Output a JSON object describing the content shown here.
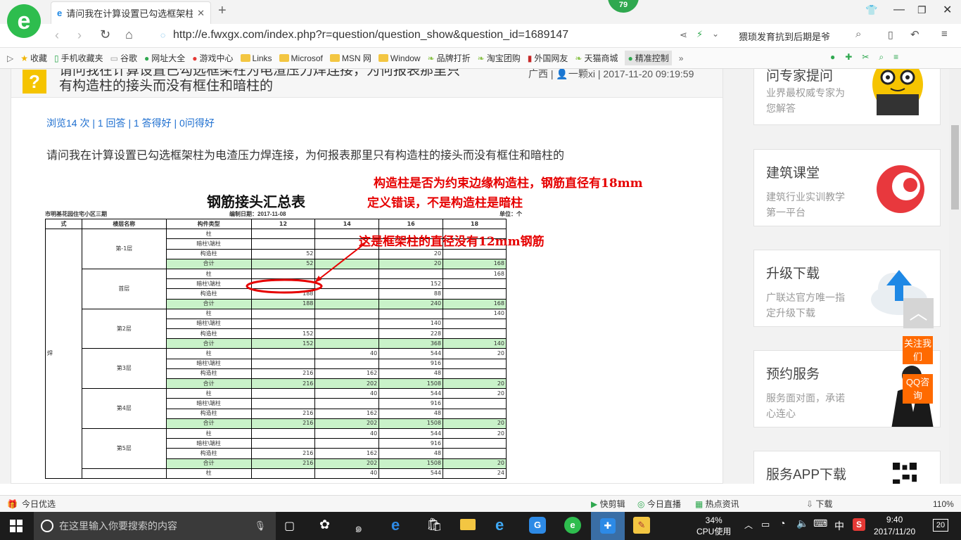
{
  "browser": {
    "tab_title": "请问我在计算设置已勾选框架柱为",
    "url": "http://e.fwxgx.com/index.php?r=question/question_show&question_id=1689147",
    "search_text": "猥琐发育抗到后期是爷",
    "badge_count": "79",
    "zoom": "110%"
  },
  "favorites": [
    "收藏",
    "手机收藏夹",
    "谷歌",
    "网址大全",
    "游戏中心",
    "Links",
    "Microsof",
    "MSN 网",
    "Window",
    "品牌打折",
    "淘宝团购",
    "外国网友",
    "天猫商城",
    "精准控制"
  ],
  "question": {
    "title_line1": "请问我在计算设置已勾选框架柱为电渣压力焊连接，为何报表那里只",
    "title_line2": "有构造柱的接头而没有框住和暗柱的",
    "meta_region": "广西",
    "meta_user": "一颗xi",
    "meta_date": "2017-11-20 09:19:59",
    "stats": "浏览14 次 | 1 回答 | 1 答得好 | 0问得好",
    "body": "请问我在计算设置已勾选框架柱为电渣压力焊连接，为何报表那里只有构造柱的接头而没有框住和暗柱的",
    "annotation1": "构造柱是否为约束边缘构造柱，钢筋直径有18mm",
    "annotation2": "定义错误，不是构造柱是暗柱",
    "annotation3": "这是框架柱的直径没有12mm钢筋"
  },
  "report": {
    "title": "钢筋接头汇总表",
    "project": "市明基花园住宅小区三期",
    "date_label": "编制日期：2017-11-08",
    "unit_label": "单位：个",
    "headers": [
      "式",
      "楼层名称",
      "构件类型",
      "12",
      "14",
      "16",
      "18"
    ],
    "side_label": "焊",
    "floors": [
      {
        "name": "第-1层",
        "rows": [
          [
            "柱",
            "",
            "",
            "",
            ""
          ],
          [
            "暗柱\\端柱",
            "",
            "",
            "",
            ""
          ],
          [
            "构造柱",
            "52",
            "",
            "20",
            ""
          ],
          [
            "合计",
            "52",
            "",
            "20",
            "168"
          ]
        ]
      },
      {
        "name": "首层",
        "rows": [
          [
            "柱",
            "",
            "",
            "",
            "168"
          ],
          [
            "暗柱\\端柱",
            "",
            "",
            "152",
            ""
          ],
          [
            "构造柱",
            "188",
            "",
            "88",
            ""
          ],
          [
            "合计",
            "188",
            "",
            "240",
            "168"
          ]
        ]
      },
      {
        "name": "第2层",
        "rows": [
          [
            "柱",
            "",
            "",
            "",
            "140"
          ],
          [
            "暗柱\\端柱",
            "",
            "",
            "140",
            ""
          ],
          [
            "构造柱",
            "152",
            "",
            "228",
            ""
          ],
          [
            "合计",
            "152",
            "",
            "368",
            "140"
          ]
        ]
      },
      {
        "name": "第3层",
        "rows": [
          [
            "柱",
            "",
            "40",
            "544",
            "20"
          ],
          [
            "暗柱\\端柱",
            "",
            "",
            "916",
            ""
          ],
          [
            "构造柱",
            "216",
            "162",
            "48",
            ""
          ],
          [
            "合计",
            "216",
            "202",
            "1508",
            "20"
          ]
        ]
      },
      {
        "name": "第4层",
        "rows": [
          [
            "柱",
            "",
            "40",
            "544",
            "20"
          ],
          [
            "暗柱\\端柱",
            "",
            "",
            "916",
            ""
          ],
          [
            "构造柱",
            "216",
            "162",
            "48",
            ""
          ],
          [
            "合计",
            "216",
            "202",
            "1508",
            "20"
          ]
        ]
      },
      {
        "name": "第5层",
        "rows": [
          [
            "柱",
            "",
            "40",
            "544",
            "20"
          ],
          [
            "暗柱\\端柱",
            "",
            "",
            "916",
            ""
          ],
          [
            "构造柱",
            "216",
            "162",
            "48",
            ""
          ],
          [
            "合计",
            "216",
            "202",
            "1508",
            "20"
          ]
        ]
      },
      {
        "name": "",
        "rows": [
          [
            "柱",
            "",
            "40",
            "544",
            "24"
          ]
        ]
      }
    ]
  },
  "sidebar": [
    {
      "title": "问专家提问",
      "sub": "业界最权威专家为您解答"
    },
    {
      "title": "建筑课堂",
      "sub": "建筑行业实训教学第一平台"
    },
    {
      "title": "升级下载",
      "sub": "广联达官方唯一指定升级下载"
    },
    {
      "title": "预约服务",
      "sub": "服务面对面，承诺心连心"
    },
    {
      "title": "服务APP下载",
      "sub": ""
    }
  ],
  "float_buttons": {
    "follow": "关注我们",
    "qq": "QQ咨询"
  },
  "statusbar": {
    "left": "今日优选",
    "items": [
      "快剪辑",
      "今日直播",
      "热点资讯",
      "下载"
    ]
  },
  "taskbar": {
    "search_placeholder": "在这里输入你要搜索的内容",
    "cpu_percent": "34%",
    "cpu_label": "CPU使用",
    "ime": "中",
    "time": "9:40",
    "date": "2017/11/20",
    "notif_count": "20"
  },
  "colors": {
    "accent": "#1e6fd0",
    "annotation": "#e60000",
    "total_row": "#c9f2c9",
    "orange": "#ff6a00"
  }
}
